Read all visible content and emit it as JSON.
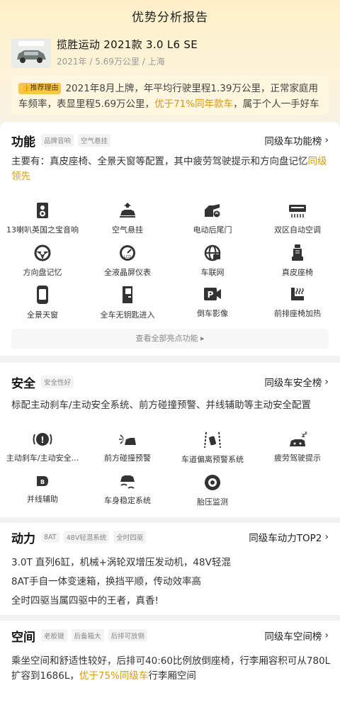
{
  "page_title": "优势分析报告",
  "car": {
    "name": "揽胜运动 2021款 3.0 L6 SE",
    "sub": "2021年 / 5.69万公里 / 上海",
    "thumb_alt": "car-photo"
  },
  "reason": {
    "tag": "推荐理由",
    "text_before": "2021年8月上牌，年平均行驶里程1.39万公里，正常家庭用车频率，表显里程5.69万公里，",
    "highlight": "优于71%同年款车",
    "text_after": "，属于个人一手好车"
  },
  "function": {
    "title": "功能",
    "tags": [
      "品牌音响",
      "空气悬挂"
    ],
    "rank": "同级车功能榜",
    "desc_before": "主要有：真皮座椅、全景天窗等配置，其中疲劳驾驶提示和方向盘记忆",
    "desc_highlight": "同级领先",
    "features": [
      {
        "label": "13喇叭英国之宝音响",
        "icon": "speaker-icon"
      },
      {
        "label": "空气悬挂",
        "icon": "air-suspension-icon"
      },
      {
        "label": "电动后尾门",
        "icon": "power-tailgate-icon"
      },
      {
        "label": "双区自动空调",
        "icon": "dual-zone-ac-icon"
      },
      {
        "label": "方向盘记忆",
        "icon": "steering-wheel-icon"
      },
      {
        "label": "全液晶屏仪表",
        "icon": "lcd-dashboard-icon"
      },
      {
        "label": "车联网",
        "icon": "car-network-icon"
      },
      {
        "label": "真皮座椅",
        "icon": "leather-seat-icon"
      },
      {
        "label": "全景天窗",
        "icon": "panoramic-sunroof-icon"
      },
      {
        "label": "全车无钥匙进入",
        "icon": "keyless-entry-icon"
      },
      {
        "label": "倒车影像",
        "icon": "reverse-camera-icon"
      },
      {
        "label": "前排座椅加热",
        "icon": "seat-heating-icon"
      }
    ],
    "view_all": "查看全部亮点功能 ▸"
  },
  "safety": {
    "title": "安全",
    "tags": [
      "安全性好"
    ],
    "rank": "同级车安全榜",
    "desc": "标配主动刹车/主动安全系统、前方碰撞预警、并线辅助等主动安全配置",
    "features": [
      {
        "label": "主动刹车/主动安全...",
        "icon": "active-brake-icon"
      },
      {
        "label": "前方碰撞预警",
        "icon": "collision-warning-icon"
      },
      {
        "label": "车道偏离预警系统",
        "icon": "lane-departure-icon"
      },
      {
        "label": "疲劳驾驶提示",
        "icon": "fatigue-alert-icon"
      },
      {
        "label": "并线辅助",
        "icon": "blind-spot-icon"
      },
      {
        "label": "车身稳定系统",
        "icon": "stability-control-icon"
      },
      {
        "label": "胎压监测",
        "icon": "tire-pressure-icon"
      }
    ]
  },
  "power": {
    "title": "动力",
    "tags": [
      "8AT",
      "48V轻混系统",
      "全时四驱"
    ],
    "rank": "同级车动力TOP2",
    "lines": [
      "3.0T 直列6缸，机械+涡轮双增压发动机，48V轻混",
      "8AT手自一体变速箱，换挡平顺，传动效率高",
      "全时四驱当属四驱中的王者，真香!"
    ]
  },
  "space": {
    "title": "空间",
    "tags": [
      "老板键",
      "后备箱大",
      "后排可放倒"
    ],
    "rank": "同级车空间榜",
    "desc_line1": "乘坐空间和舒适性较好，后排可40:60比例放倒座椅，行李厢容积可从780L",
    "desc_line2_before": "扩容到1686L，",
    "desc_highlight": "优于75%同级车",
    "desc_line2_after": "行李厢空间"
  },
  "colors": {
    "accent": "#d89a10",
    "tag_yellow": "#f5c64b",
    "hero_bg": "#fdf0c8"
  }
}
